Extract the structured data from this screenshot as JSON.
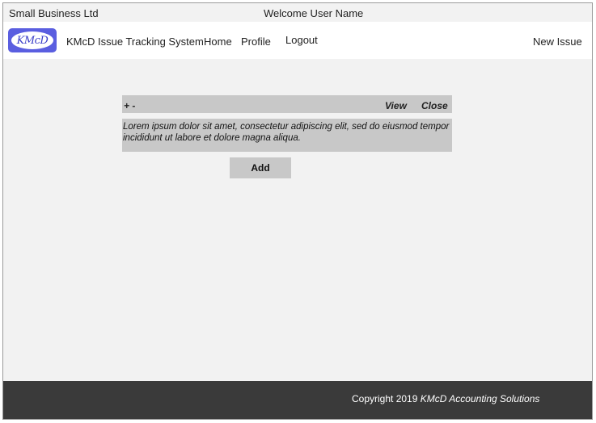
{
  "topbar": {
    "company": "Small Business Ltd",
    "welcome": "Welcome User Name"
  },
  "navbar": {
    "logo_text": "KMcD",
    "title": "KMcD Issue Tracking System",
    "links": {
      "home": "Home",
      "profile": "Profile",
      "logout": "Logout"
    },
    "new_issue": "New Issue"
  },
  "issue_card": {
    "expand_collapse": "+ -",
    "view_label": "View",
    "close_label": "Close",
    "description": "Lorem ipsum dolor sit amet, consectetur adipiscing elit, sed do eiusmod tempor incididunt ut labore et dolore magna aliqua."
  },
  "add_button": "Add",
  "footer": {
    "copyright_prefix": "Copyright 2019 ",
    "organization": "KMcD Accounting Solutions"
  },
  "colors": {
    "logo_blue": "#5a5ee0",
    "panel_gray": "#c8c8c8",
    "footer_dark": "#3a3a3a",
    "background": "#f2f2f2"
  }
}
